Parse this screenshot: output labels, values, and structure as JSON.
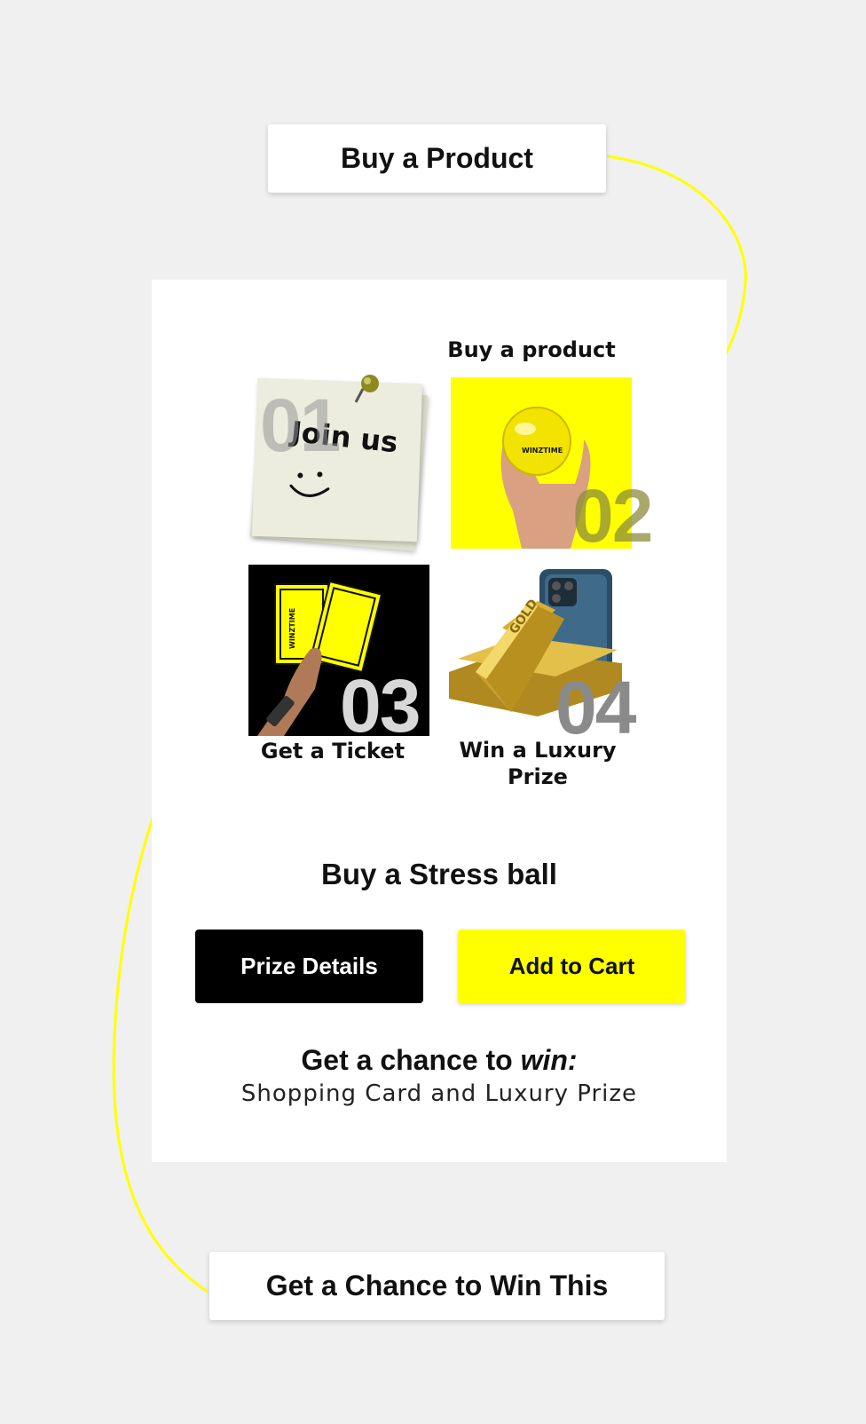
{
  "callouts": {
    "top": "Buy a Product",
    "bottom": "Get a Chance to Win This"
  },
  "steps": [
    {
      "number": "01",
      "image_text": "Join us",
      "caption": ""
    },
    {
      "number": "02",
      "caption": "Buy a product",
      "brand": "WINZTIME"
    },
    {
      "number": "03",
      "caption": "Get a Ticket",
      "brand": "WINZTIME"
    },
    {
      "number": "04",
      "caption_line1": "Win a Luxury",
      "caption_line2": "Prize",
      "bar_text": "GOLD"
    }
  ],
  "product": {
    "title": "Buy a Stress ball",
    "prize_button": "Prize Details",
    "cart_button": "Add to Cart"
  },
  "chance": {
    "lead": "Get a chance to",
    "emphasis": "win:",
    "prizes": "Shopping Card and Luxury Prize"
  },
  "colors": {
    "accent_yellow": "#ffff00",
    "page_bg": "#f0f0f0",
    "arrow": "#ffff00"
  }
}
